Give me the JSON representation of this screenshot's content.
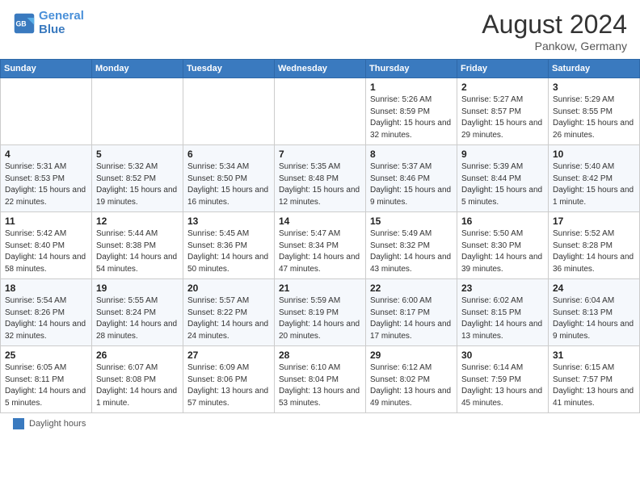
{
  "header": {
    "logo_line1": "General",
    "logo_line2": "Blue",
    "month_year": "August 2024",
    "location": "Pankow, Germany"
  },
  "weekdays": [
    "Sunday",
    "Monday",
    "Tuesday",
    "Wednesday",
    "Thursday",
    "Friday",
    "Saturday"
  ],
  "legend": {
    "label": "Daylight hours"
  },
  "weeks": [
    [
      {
        "day": "",
        "info": ""
      },
      {
        "day": "",
        "info": ""
      },
      {
        "day": "",
        "info": ""
      },
      {
        "day": "",
        "info": ""
      },
      {
        "day": "1",
        "info": "Sunrise: 5:26 AM\nSunset: 8:59 PM\nDaylight: 15 hours and 32 minutes."
      },
      {
        "day": "2",
        "info": "Sunrise: 5:27 AM\nSunset: 8:57 PM\nDaylight: 15 hours and 29 minutes."
      },
      {
        "day": "3",
        "info": "Sunrise: 5:29 AM\nSunset: 8:55 PM\nDaylight: 15 hours and 26 minutes."
      }
    ],
    [
      {
        "day": "4",
        "info": "Sunrise: 5:31 AM\nSunset: 8:53 PM\nDaylight: 15 hours and 22 minutes."
      },
      {
        "day": "5",
        "info": "Sunrise: 5:32 AM\nSunset: 8:52 PM\nDaylight: 15 hours and 19 minutes."
      },
      {
        "day": "6",
        "info": "Sunrise: 5:34 AM\nSunset: 8:50 PM\nDaylight: 15 hours and 16 minutes."
      },
      {
        "day": "7",
        "info": "Sunrise: 5:35 AM\nSunset: 8:48 PM\nDaylight: 15 hours and 12 minutes."
      },
      {
        "day": "8",
        "info": "Sunrise: 5:37 AM\nSunset: 8:46 PM\nDaylight: 15 hours and 9 minutes."
      },
      {
        "day": "9",
        "info": "Sunrise: 5:39 AM\nSunset: 8:44 PM\nDaylight: 15 hours and 5 minutes."
      },
      {
        "day": "10",
        "info": "Sunrise: 5:40 AM\nSunset: 8:42 PM\nDaylight: 15 hours and 1 minute."
      }
    ],
    [
      {
        "day": "11",
        "info": "Sunrise: 5:42 AM\nSunset: 8:40 PM\nDaylight: 14 hours and 58 minutes."
      },
      {
        "day": "12",
        "info": "Sunrise: 5:44 AM\nSunset: 8:38 PM\nDaylight: 14 hours and 54 minutes."
      },
      {
        "day": "13",
        "info": "Sunrise: 5:45 AM\nSunset: 8:36 PM\nDaylight: 14 hours and 50 minutes."
      },
      {
        "day": "14",
        "info": "Sunrise: 5:47 AM\nSunset: 8:34 PM\nDaylight: 14 hours and 47 minutes."
      },
      {
        "day": "15",
        "info": "Sunrise: 5:49 AM\nSunset: 8:32 PM\nDaylight: 14 hours and 43 minutes."
      },
      {
        "day": "16",
        "info": "Sunrise: 5:50 AM\nSunset: 8:30 PM\nDaylight: 14 hours and 39 minutes."
      },
      {
        "day": "17",
        "info": "Sunrise: 5:52 AM\nSunset: 8:28 PM\nDaylight: 14 hours and 36 minutes."
      }
    ],
    [
      {
        "day": "18",
        "info": "Sunrise: 5:54 AM\nSunset: 8:26 PM\nDaylight: 14 hours and 32 minutes."
      },
      {
        "day": "19",
        "info": "Sunrise: 5:55 AM\nSunset: 8:24 PM\nDaylight: 14 hours and 28 minutes."
      },
      {
        "day": "20",
        "info": "Sunrise: 5:57 AM\nSunset: 8:22 PM\nDaylight: 14 hours and 24 minutes."
      },
      {
        "day": "21",
        "info": "Sunrise: 5:59 AM\nSunset: 8:19 PM\nDaylight: 14 hours and 20 minutes."
      },
      {
        "day": "22",
        "info": "Sunrise: 6:00 AM\nSunset: 8:17 PM\nDaylight: 14 hours and 17 minutes."
      },
      {
        "day": "23",
        "info": "Sunrise: 6:02 AM\nSunset: 8:15 PM\nDaylight: 14 hours and 13 minutes."
      },
      {
        "day": "24",
        "info": "Sunrise: 6:04 AM\nSunset: 8:13 PM\nDaylight: 14 hours and 9 minutes."
      }
    ],
    [
      {
        "day": "25",
        "info": "Sunrise: 6:05 AM\nSunset: 8:11 PM\nDaylight: 14 hours and 5 minutes."
      },
      {
        "day": "26",
        "info": "Sunrise: 6:07 AM\nSunset: 8:08 PM\nDaylight: 14 hours and 1 minute."
      },
      {
        "day": "27",
        "info": "Sunrise: 6:09 AM\nSunset: 8:06 PM\nDaylight: 13 hours and 57 minutes."
      },
      {
        "day": "28",
        "info": "Sunrise: 6:10 AM\nSunset: 8:04 PM\nDaylight: 13 hours and 53 minutes."
      },
      {
        "day": "29",
        "info": "Sunrise: 6:12 AM\nSunset: 8:02 PM\nDaylight: 13 hours and 49 minutes."
      },
      {
        "day": "30",
        "info": "Sunrise: 6:14 AM\nSunset: 7:59 PM\nDaylight: 13 hours and 45 minutes."
      },
      {
        "day": "31",
        "info": "Sunrise: 6:15 AM\nSunset: 7:57 PM\nDaylight: 13 hours and 41 minutes."
      }
    ]
  ]
}
